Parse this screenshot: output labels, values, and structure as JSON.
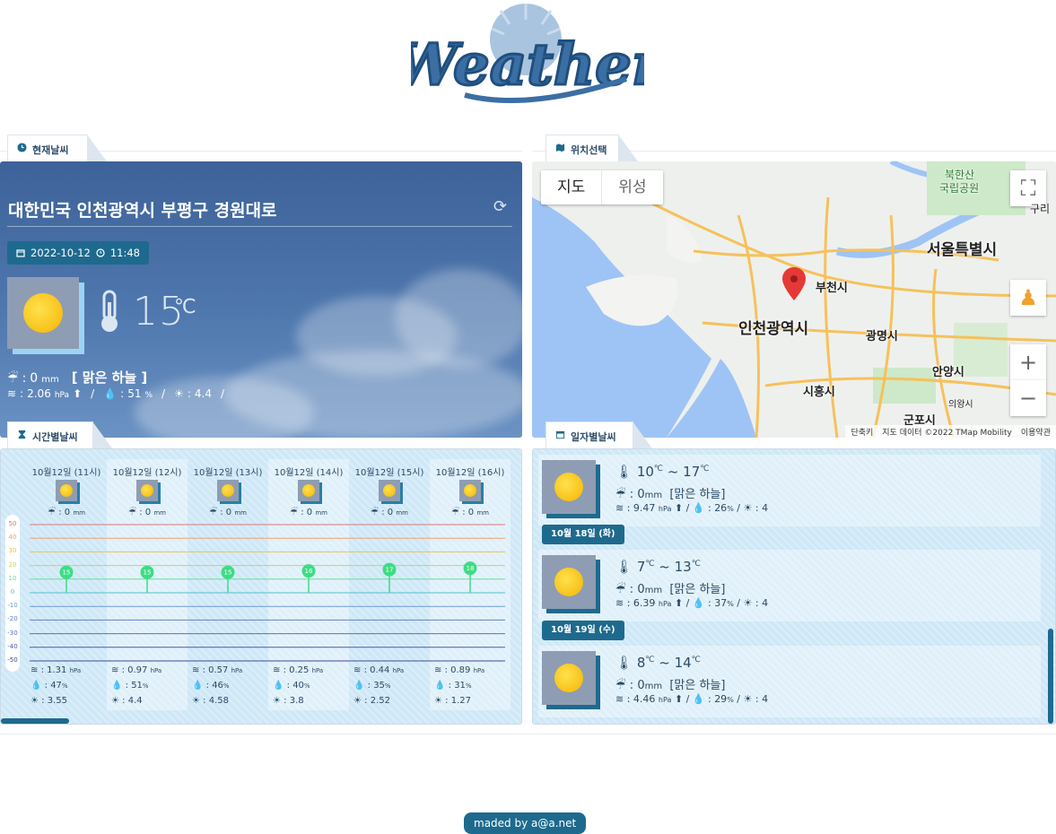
{
  "logo": {
    "text": "Weather"
  },
  "tabs": {
    "current": "현재날씨",
    "location": "위치선택",
    "hourly": "시간별날씨",
    "daily": "일자별날씨"
  },
  "current": {
    "address": "대한민국 인천광역시 부평구 경원대로",
    "date": "2022-10-12",
    "time": "11:48",
    "temp": "15",
    "temp_unit": "℃",
    "rain": "0",
    "rain_unit": "mm",
    "sky": "[ 맑은 하늘 ]",
    "wind": "2.06",
    "wind_unit": "hPa",
    "humidity": "51",
    "humidity_unit": "%",
    "uv": "4.4",
    "sep": "/"
  },
  "map": {
    "btn_map": "지도",
    "btn_satellite": "위성",
    "labels": {
      "incheon": "인천광역시",
      "seoul": "서울특별시",
      "bucheon": "부천시",
      "gwangmyeong": "광명시",
      "anyang": "안양시",
      "siheung": "시흥시",
      "gunpo": "군포시",
      "uiwang": "의왕시",
      "bukhansan": "북한산",
      "park": "국립공원",
      "gu": "구리"
    },
    "roads": [
      "400",
      "130",
      "130",
      "400",
      "100",
      "120",
      "88",
      "1",
      "110",
      "100",
      "17",
      "15",
      "110",
      "77",
      "50",
      "66",
      "48",
      "39",
      "3",
      "88",
      "110",
      "1"
    ],
    "footer_shortcut": "단축키",
    "footer_data": "지도 데이터 ©2022 TMap Mobility",
    "footer_terms": "이용약관"
  },
  "hourly": {
    "scale": [
      "50",
      "40",
      "30",
      "20",
      "10",
      "0",
      "-10",
      "-20",
      "-30",
      "-40",
      "-50"
    ],
    "items": [
      {
        "time": "10월12일 (11시)",
        "rain": "0",
        "temp": "15",
        "wind": "1.31",
        "hum": "47",
        "uv": "3.55"
      },
      {
        "time": "10월12일 (12시)",
        "rain": "0",
        "temp": "15",
        "wind": "0.97",
        "hum": "51",
        "uv": "4.4"
      },
      {
        "time": "10월12일 (13시)",
        "rain": "0",
        "temp": "15",
        "wind": "0.57",
        "hum": "46",
        "uv": "4.58"
      },
      {
        "time": "10월12일 (14시)",
        "rain": "0",
        "temp": "16",
        "wind": "0.25",
        "hum": "40",
        "uv": "3.8"
      },
      {
        "time": "10월12일 (15시)",
        "rain": "0",
        "temp": "17",
        "wind": "0.44",
        "hum": "35",
        "uv": "2.52"
      },
      {
        "time": "10월12일 (16시)",
        "rain": "0",
        "temp": "18",
        "wind": "0.89",
        "hum": "31",
        "uv": "1.27"
      }
    ],
    "units": {
      "rain": "mm",
      "wind": "hPa",
      "hum": "%"
    }
  },
  "daily": {
    "items": [
      {
        "label": "",
        "min": "10",
        "max": "17",
        "rain": "0",
        "sky": "[맑은 하늘]",
        "wind": "9.47",
        "hum": "26",
        "uv": "4"
      },
      {
        "label": "10월 18일 (화)",
        "min": "7",
        "max": "13",
        "rain": "0",
        "sky": "[맑은 하늘]",
        "wind": "6.39",
        "hum": "37",
        "uv": "4"
      },
      {
        "label": "10월 19일 (수)",
        "min": "8",
        "max": "14",
        "rain": "0",
        "sky": "[맑은 하늘]",
        "wind": "4.46",
        "hum": "29",
        "uv": "4"
      }
    ],
    "temp_unit": "℃",
    "tilde": "~",
    "rain_unit": "mm",
    "wind_unit": "hPa",
    "hum_unit": "%"
  },
  "footer": {
    "text": "maded by a@a.net"
  },
  "colors": {
    "accent": "#1e6a8e",
    "panel": "#cfe8f7",
    "sky": "#4f78ae"
  }
}
